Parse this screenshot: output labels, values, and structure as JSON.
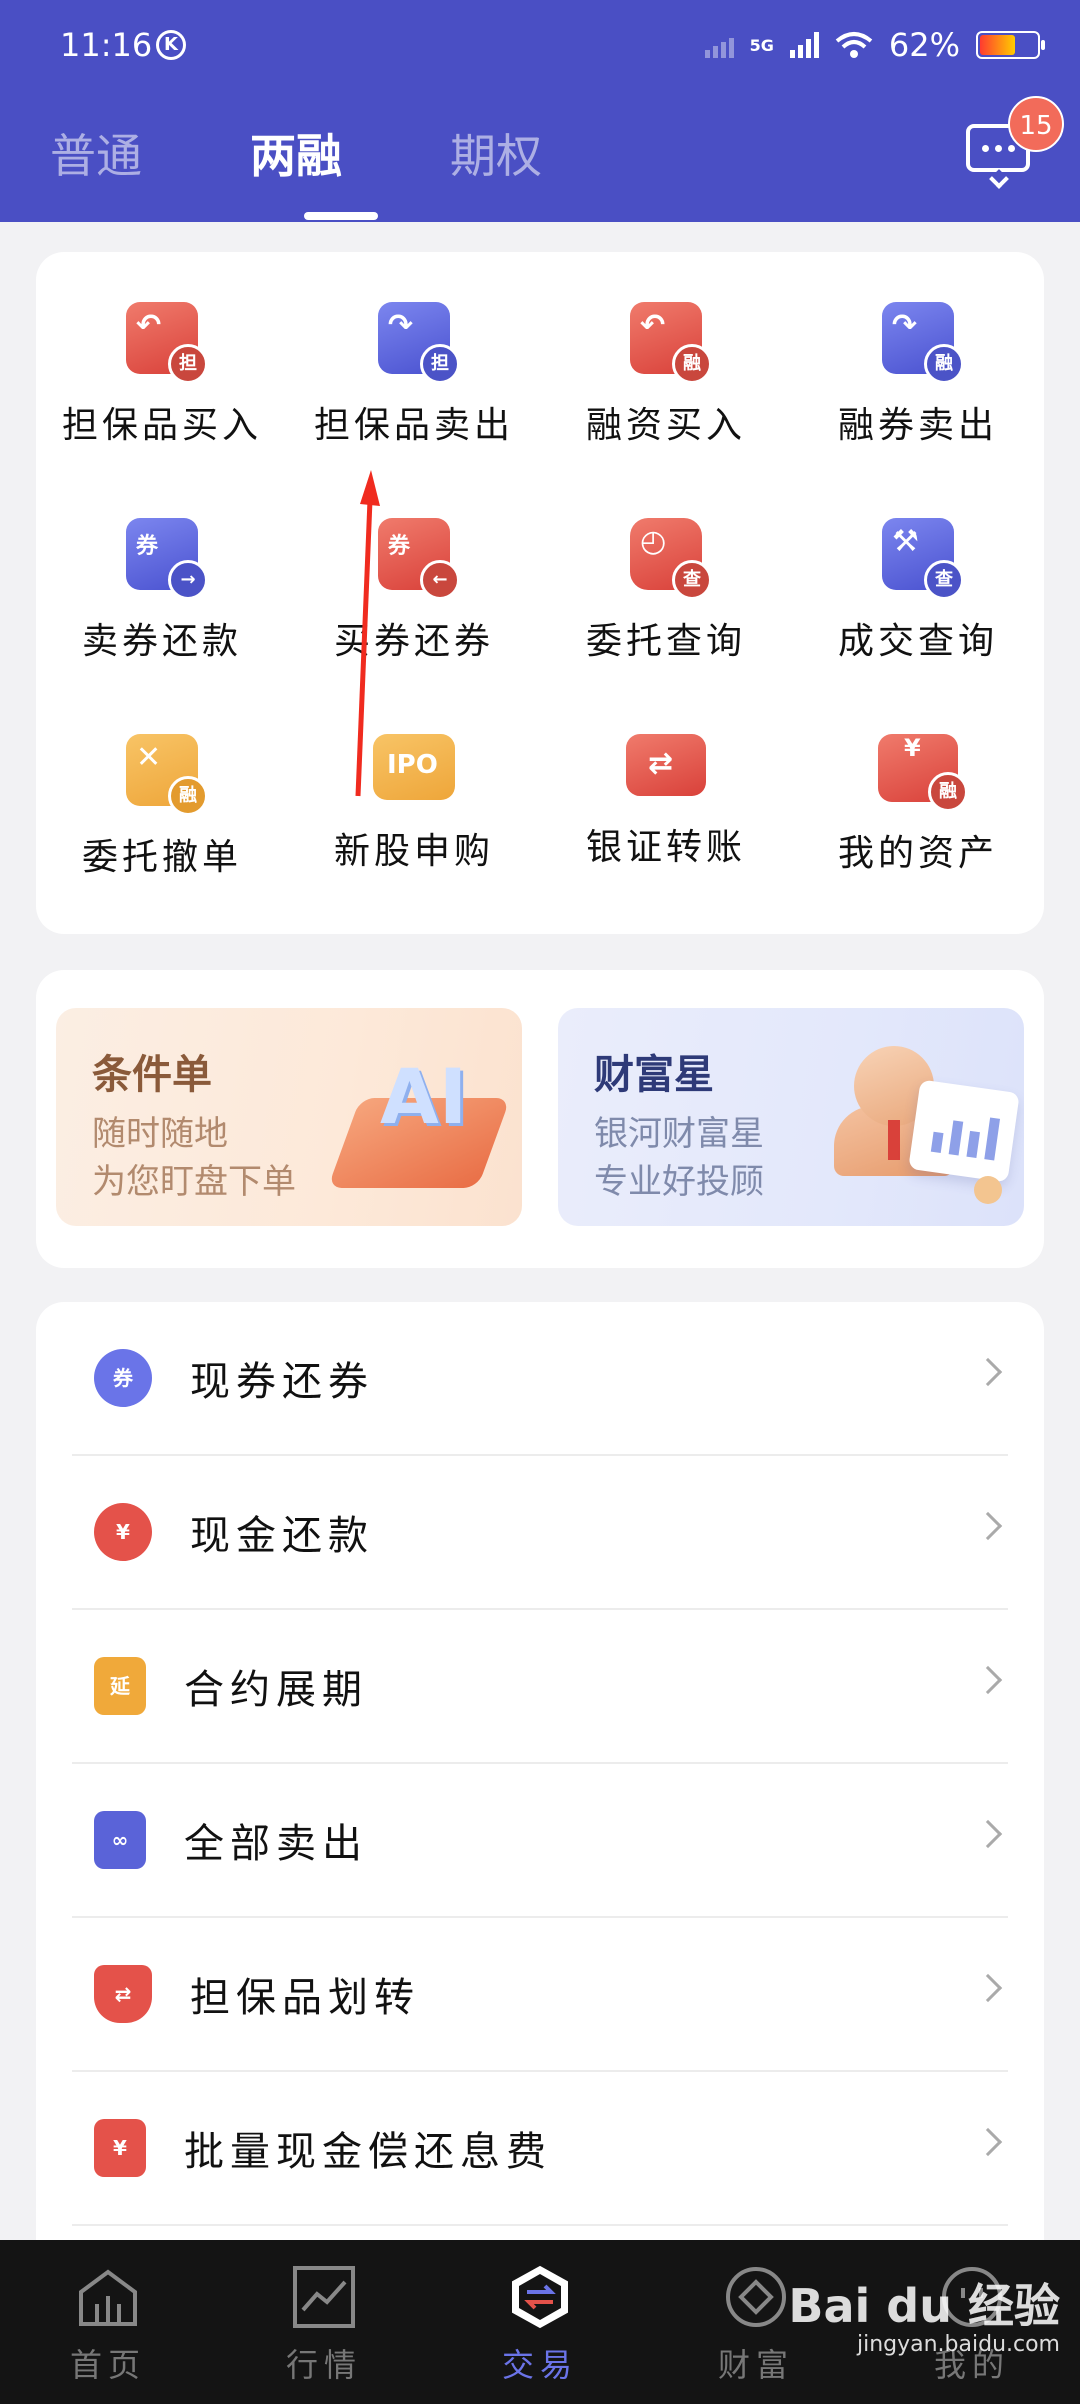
{
  "status": {
    "time": "11:16",
    "k_badge": "K",
    "network": "5G",
    "battery": "62%"
  },
  "header": {
    "tabs": [
      {
        "label": "普通",
        "active": false
      },
      {
        "label": "两融",
        "active": true
      },
      {
        "label": "期权",
        "active": false
      }
    ],
    "message_count": "15"
  },
  "grid": {
    "items": [
      {
        "label": "担保品买入",
        "color": "red",
        "glyph": "↶",
        "sub": "担"
      },
      {
        "label": "担保品卖出",
        "color": "blue",
        "glyph": "↷",
        "sub": "担"
      },
      {
        "label": "融资买入",
        "color": "red",
        "glyph": "↶",
        "sub": "融"
      },
      {
        "label": "融券卖出",
        "color": "blue",
        "glyph": "↷",
        "sub": "融"
      },
      {
        "label": "卖券还款",
        "color": "blue",
        "glyph": "券",
        "sub": "→"
      },
      {
        "label": "买券还券",
        "color": "red",
        "glyph": "券",
        "sub": "←"
      },
      {
        "label": "委托查询",
        "color": "red",
        "glyph": "◴",
        "sub": "查"
      },
      {
        "label": "成交查询",
        "color": "blue",
        "glyph": "⚒",
        "sub": "查"
      },
      {
        "label": "委托撤单",
        "color": "orange",
        "glyph": "✕",
        "sub": "融"
      },
      {
        "label": "新股申购",
        "color": "orange",
        "glyph": "IPO",
        "sub": ""
      },
      {
        "label": "银证转账",
        "color": "red",
        "glyph": "⇄",
        "sub": ""
      },
      {
        "label": "我的资产",
        "color": "red",
        "glyph": "¥",
        "sub": "融"
      }
    ]
  },
  "banners": [
    {
      "title": "条件单",
      "line1": "随时随地",
      "line2": "为您盯盘下单",
      "art": "AI"
    },
    {
      "title": "财富星",
      "line1": "银河财富星",
      "line2": "专业好投顾"
    }
  ],
  "list": {
    "items": [
      {
        "label": "现券还券",
        "icon": "券",
        "color": "#6a74e8"
      },
      {
        "label": "现金还款",
        "icon": "¥",
        "color": "#e4524a"
      },
      {
        "label": "合约展期",
        "icon": "延",
        "color": "#f0a93a"
      },
      {
        "label": "全部卖出",
        "icon": "∞",
        "color": "#5a63d8"
      },
      {
        "label": "担保品划转",
        "icon": "⇄",
        "color": "#e4524a"
      },
      {
        "label": "批量现金偿还息费",
        "icon": "¥",
        "color": "#e4524a"
      }
    ]
  },
  "bottom_nav": [
    {
      "label": "首页",
      "icon": "home-icon",
      "active": false
    },
    {
      "label": "行情",
      "icon": "chart-icon",
      "active": false
    },
    {
      "label": "交易",
      "icon": "trade-icon",
      "active": true
    },
    {
      "label": "财富",
      "icon": "wealth-icon",
      "active": false
    },
    {
      "label": "我的",
      "icon": "user-icon",
      "active": false
    }
  ],
  "watermark": {
    "brand": "Bai du 经验",
    "url": "jingyan.baidu.com"
  }
}
